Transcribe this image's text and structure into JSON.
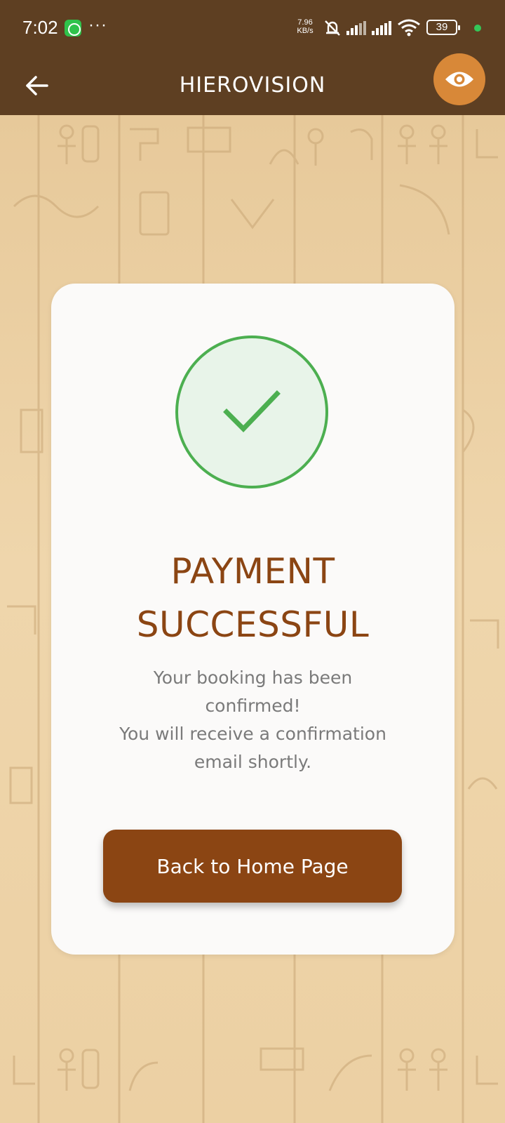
{
  "status_bar": {
    "time": "7:02",
    "more": "···",
    "net_speed_value": "7.96",
    "net_speed_unit": "KB/s",
    "battery": "39"
  },
  "app_bar": {
    "title": "HIEROVISION"
  },
  "card": {
    "title_line1": "PAYMENT",
    "title_line2": "SUCCESSFUL",
    "message_line1": "Your booking has been",
    "message_line2": "confirmed!",
    "message_line3": "You will receive a confirmation",
    "message_line4": "email shortly.",
    "button_label": "Back to Home Page"
  },
  "colors": {
    "app_bar_bg": "#5e3f22",
    "accent_orange": "#d88838",
    "brand_brown": "#8b4513",
    "success_green": "#4caf50",
    "card_bg": "#fbfaf9",
    "background_sand": "#e9cfa4"
  },
  "icons": {
    "back": "arrow-left-icon",
    "eye": "eye-icon",
    "success": "checkmark-icon"
  }
}
